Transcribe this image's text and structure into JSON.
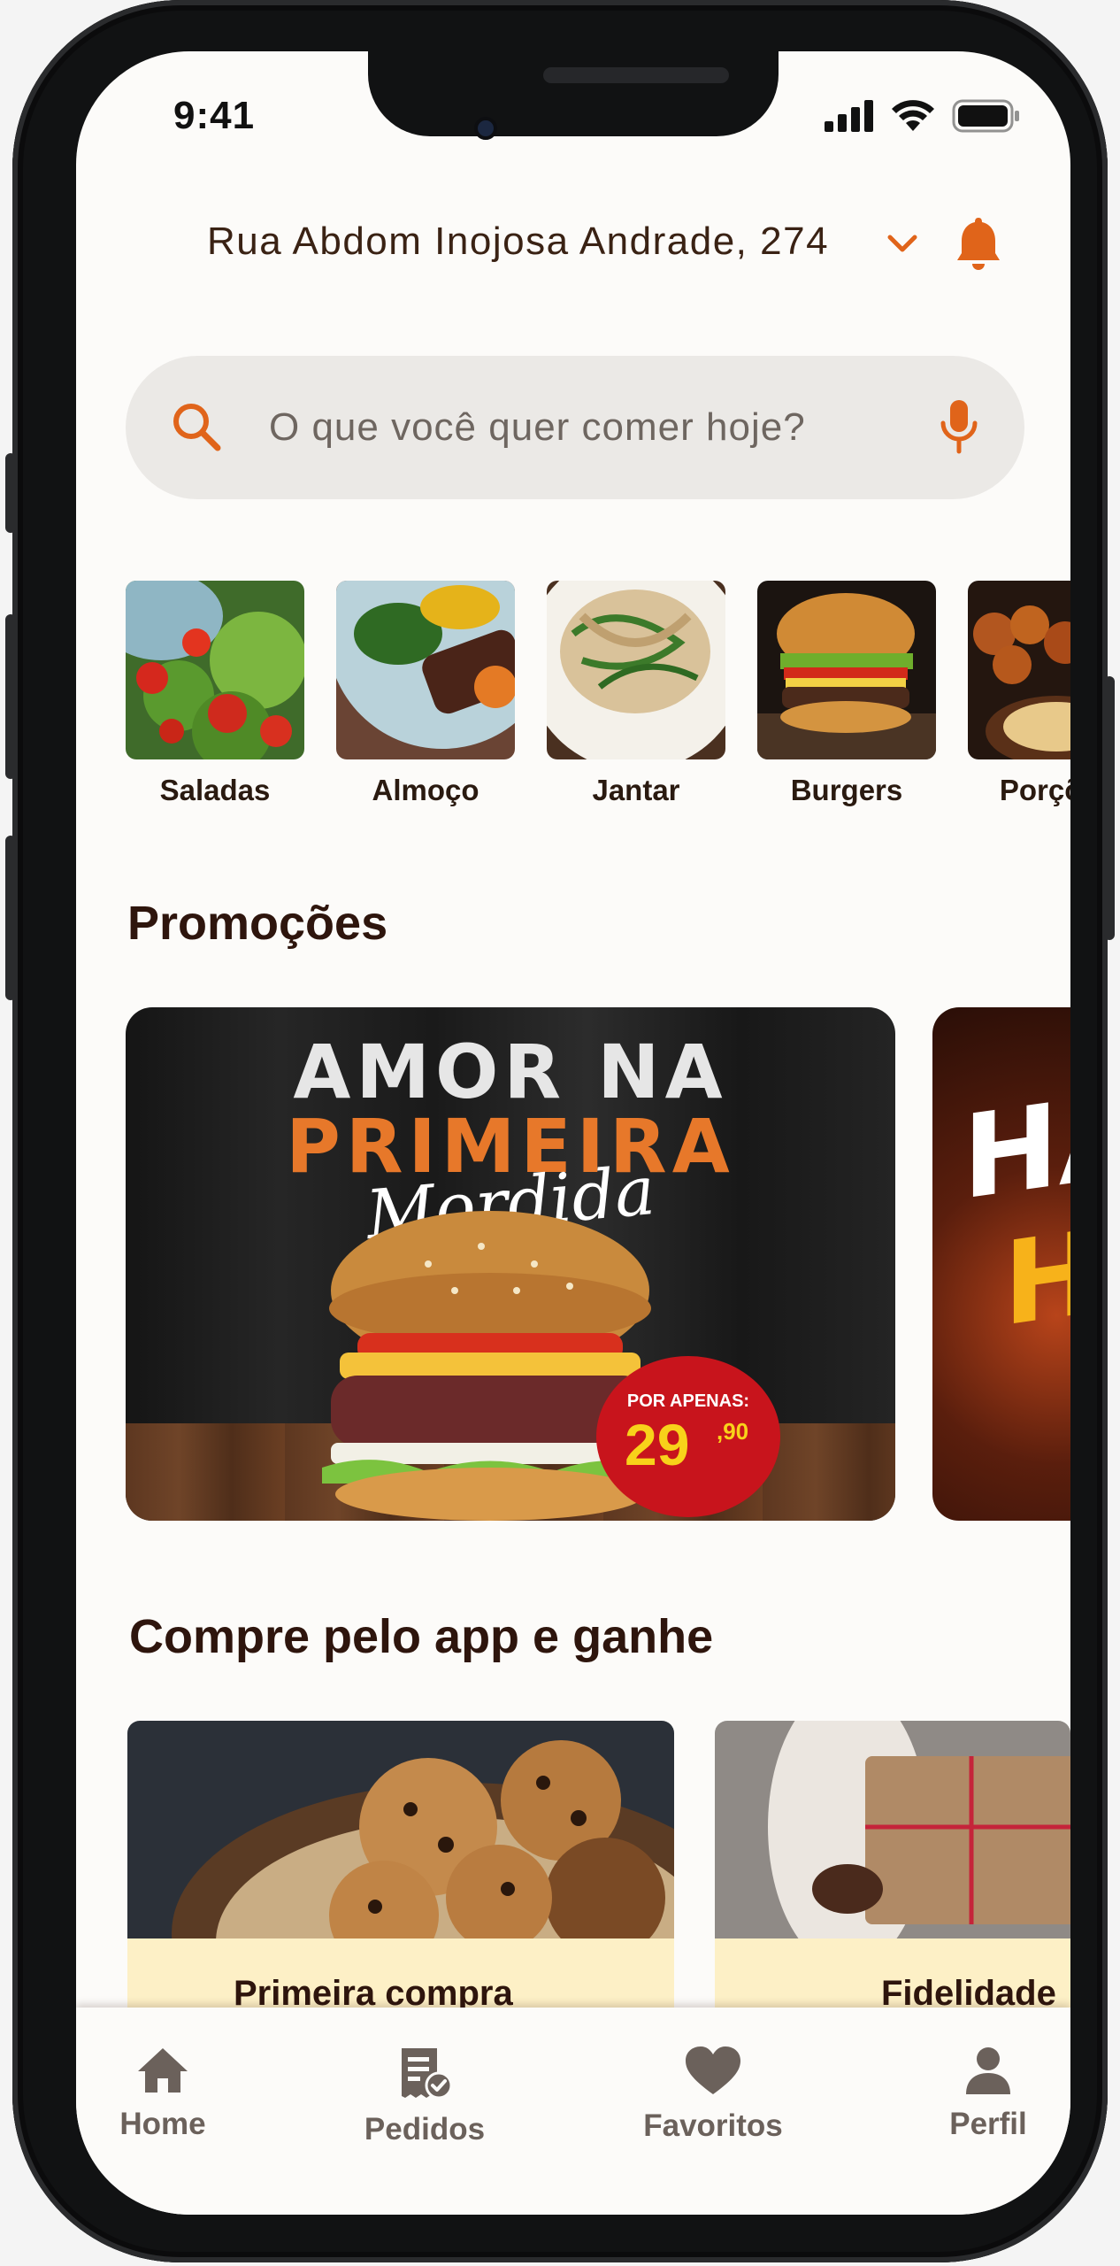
{
  "status_bar": {
    "time": "9:41"
  },
  "header": {
    "address": "Rua Abdom Inojosa Andrade, 274"
  },
  "search": {
    "placeholder": "O que você quer comer hoje?"
  },
  "categories": [
    {
      "label": "Saladas"
    },
    {
      "label": "Almoço"
    },
    {
      "label": "Jantar"
    },
    {
      "label": "Burgers"
    },
    {
      "label": "Porções"
    }
  ],
  "promotions": {
    "title": "Promoções",
    "banner1": {
      "line1": "AMOR NA",
      "line2": "PRIMEIRA",
      "line3": "Mordida",
      "price_prefix": "POR APENAS:",
      "price": "29",
      "price_cents": ",90"
    },
    "banner2": {
      "line1": "HA",
      "line2": "H"
    }
  },
  "rewards": {
    "title": "Compre pelo app e ganhe",
    "items": [
      {
        "title": "Primeira compra"
      },
      {
        "title": "Fidelidade"
      }
    ]
  },
  "bottom_nav": {
    "items": [
      {
        "label": "Home"
      },
      {
        "label": "Pedidos"
      },
      {
        "label": "Favoritos"
      },
      {
        "label": "Perfil"
      }
    ]
  },
  "colors": {
    "accent": "#e0641a",
    "title": "#2e150d",
    "nav_inactive": "#6b615b",
    "band": "#fdf0c6"
  }
}
